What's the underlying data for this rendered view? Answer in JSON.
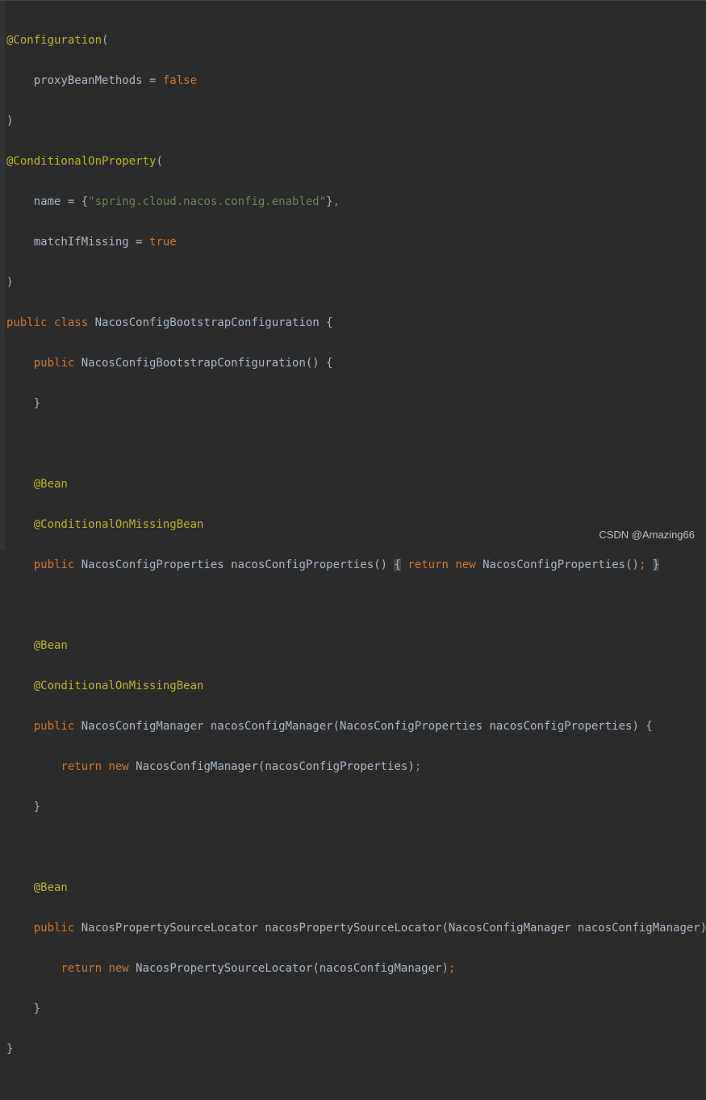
{
  "code": {
    "l1_ann": "@Configuration",
    "l1_paren": "(",
    "l2_name": "    proxyBeanMethods = ",
    "l2_val": "false",
    "l3_close": ")",
    "l4_ann": "@ConditionalOnProperty",
    "l4_paren": "(",
    "l5_a": "    name = {",
    "l5_str": "\"spring.cloud.nacos.config.enabled\"",
    "l5_b": "}",
    "l5_c": ",",
    "l6_a": "    matchIfMissing = ",
    "l6_val": "true",
    "l7_close": ")",
    "l8_pub": "public ",
    "l8_class": "class ",
    "l8_name": "NacosConfigBootstrapConfiguration {",
    "l9_pub": "    public ",
    "l9_name": "NacosConfigBootstrapConfiguration() {",
    "l10_close": "    }",
    "l12_ann": "    @Bean",
    "l13_ann": "    @ConditionalOnMissingBean",
    "l14_pub": "    public ",
    "l14_sig": "NacosConfigProperties nacosConfigProperties() ",
    "l14_br1": "{",
    "l14_sp": " ",
    "l14_ret": "return ",
    "l14_new": "new ",
    "l14_tail": "NacosConfigProperties()",
    "l14_semi": ";",
    "l14_sp2": " ",
    "l14_br2": "}",
    "l16_ann": "    @Bean",
    "l17_ann": "    @ConditionalOnMissingBean",
    "l18_pub": "    public ",
    "l18_sig": "NacosConfigManager nacosConfigManager(NacosConfigProperties nacosConfigProperties) {",
    "l19_indent": "        ",
    "l19_ret": "return ",
    "l19_new": "new ",
    "l19_tail": "NacosConfigManager(nacosConfigProperties)",
    "l19_semi": ";",
    "l20_close": "    }",
    "l22_ann": "    @Bean",
    "l23_pub": "    public ",
    "l23_sig": "NacosPropertySourceLocator nacosPropertySourceLocator(NacosConfigManager nacosConfigManager) {",
    "l24_indent": "        ",
    "l24_ret": "return ",
    "l24_new": "new ",
    "l24_tail": "NacosPropertySourceLocator(nacosConfigManager)",
    "l24_semi": ";",
    "l25_close": "    }",
    "l26_close": "}"
  },
  "watermark": "CSDN @Amazing66"
}
